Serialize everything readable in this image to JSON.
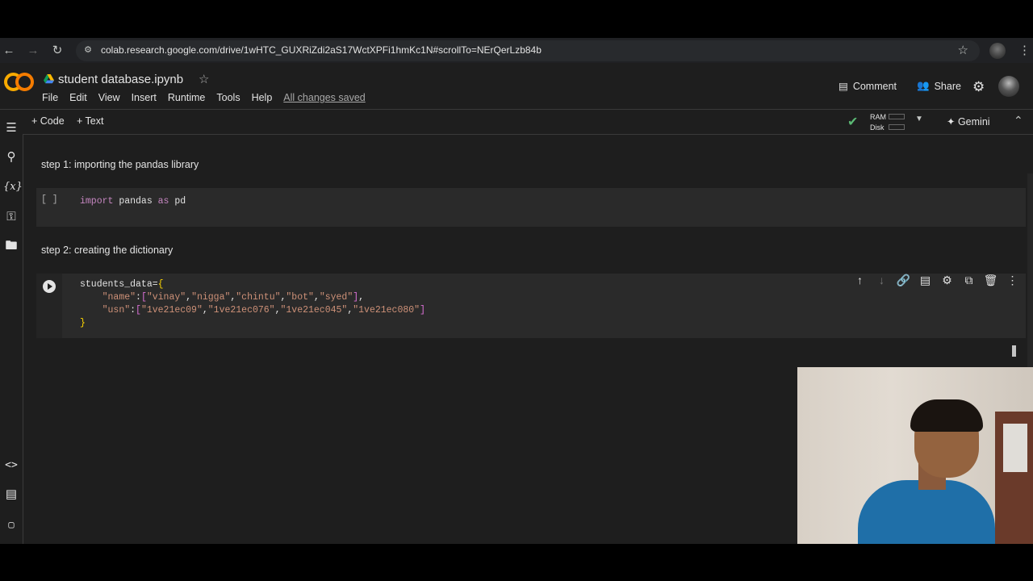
{
  "browser": {
    "url": "colab.research.google.com/drive/1wHTC_GUXRiZdi2aS17WctXPFi1hmKc1N#scrollTo=NErQerLzb84b"
  },
  "header": {
    "logo_text": "CO",
    "title": "student database.ipynb",
    "menu": [
      "File",
      "Edit",
      "View",
      "Insert",
      "Runtime",
      "Tools",
      "Help"
    ],
    "save_status": "All changes saved",
    "comment_label": "Comment",
    "share_label": "Share"
  },
  "toolbar": {
    "code_label": "Code",
    "text_label": "Text",
    "ram_label": "RAM",
    "disk_label": "Disk",
    "gemini_label": "Gemini"
  },
  "cells": {
    "text1": "step 1: importing the pandas library",
    "code1_exec": "[ ]",
    "text2": "step 2: creating the dictionary"
  },
  "colors": {
    "background": "#1e1e1e",
    "code_cell": "#2a2a2a",
    "keyword": "#c586c0",
    "string": "#ce9178",
    "accent_logo": "#f9ab00"
  }
}
